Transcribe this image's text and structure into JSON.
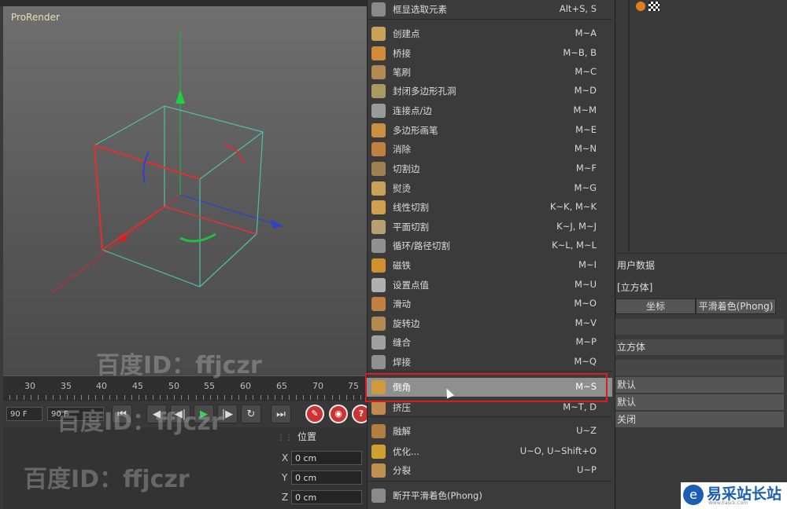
{
  "viewport": {
    "title": "ProRender"
  },
  "timeline": {
    "ticks": [
      "30",
      "35",
      "40",
      "45",
      "50",
      "55",
      "60",
      "65",
      "70",
      "75"
    ]
  },
  "transport": {
    "start_frame": "90 F",
    "end_frame": "90 F"
  },
  "coordinates": {
    "header": "位置",
    "x_label": "X",
    "x_value": "0 cm",
    "y_label": "Y",
    "y_value": "0 cm",
    "z_label": "Z",
    "z_value": "0 cm"
  },
  "menu": {
    "items": [
      {
        "label": "框显选取元素",
        "shortcut": "Alt+S, S",
        "icon": "frame-selection-icon",
        "color": "#8a8a8a"
      },
      {
        "label": "创建点",
        "shortcut": "M~A",
        "icon": "create-point-icon",
        "color": "#c9a25a"
      },
      {
        "label": "桥接",
        "shortcut": "M~B, B",
        "icon": "bridge-icon",
        "color": "#d08a3a"
      },
      {
        "label": "笔刷",
        "shortcut": "M~C",
        "icon": "brush-icon",
        "color": "#b08a50"
      },
      {
        "label": "封闭多边形孔洞",
        "shortcut": "M~D",
        "icon": "close-polygon-hole-icon",
        "color": "#a89a60"
      },
      {
        "label": "连接点/边",
        "shortcut": "M~M",
        "icon": "connect-points-edges-icon",
        "color": "#9a9a9a"
      },
      {
        "label": "多边形画笔",
        "shortcut": "M~E",
        "icon": "polygon-pen-icon",
        "color": "#c89040"
      },
      {
        "label": "消除",
        "shortcut": "M~N",
        "icon": "dissolve-icon",
        "color": "#c08040"
      },
      {
        "label": "切割边",
        "shortcut": "M~F",
        "icon": "edge-cut-icon",
        "color": "#a08050"
      },
      {
        "label": "熨烫",
        "shortcut": "M~G",
        "icon": "iron-icon",
        "color": "#c9a25a"
      },
      {
        "label": "线性切割",
        "shortcut": "K~K, M~K",
        "icon": "line-cut-icon",
        "color": "#d0a050"
      },
      {
        "label": "平面切割",
        "shortcut": "K~J, M~J",
        "icon": "plane-cut-icon",
        "color": "#b8a070"
      },
      {
        "label": "循环/路径切割",
        "shortcut": "K~L, M~L",
        "icon": "loop-path-cut-icon",
        "color": "#909090"
      },
      {
        "label": "磁铁",
        "shortcut": "M~I",
        "icon": "magnet-icon",
        "color": "#d09030"
      },
      {
        "label": "设置点值",
        "shortcut": "M~U",
        "icon": "set-point-value-icon",
        "color": "#b0b0b0"
      },
      {
        "label": "滑动",
        "shortcut": "M~O",
        "icon": "slide-icon",
        "color": "#c08040"
      },
      {
        "label": "旋转边",
        "shortcut": "M~V",
        "icon": "spin-edge-icon",
        "color": "#b08a50"
      },
      {
        "label": "缝合",
        "shortcut": "M~P",
        "icon": "stitch-icon",
        "color": "#a0a0a0"
      },
      {
        "label": "焊接",
        "shortcut": "M~Q",
        "icon": "weld-icon",
        "color": "#909090"
      },
      {
        "label": "倒角",
        "shortcut": "M~S",
        "icon": "bevel-icon",
        "color": "#d09a40",
        "highlighted": true
      },
      {
        "label": "挤压",
        "shortcut": "M~T, D",
        "icon": "extrude-icon",
        "color": "#c08a50"
      },
      {
        "label": "融解",
        "shortcut": "U~Z",
        "icon": "melt-icon",
        "color": "#b08040"
      },
      {
        "label": "优化...",
        "shortcut": "U~O, U~Shift+O",
        "icon": "optimize-icon",
        "color": "#d0a030"
      },
      {
        "label": "分裂",
        "shortcut": "U~P",
        "icon": "split-icon",
        "color": "#c09050"
      },
      {
        "label": "断开平滑着色(Phong)",
        "shortcut": "",
        "icon": "break-phong-icon",
        "color": "#8a8a8a"
      }
    ]
  },
  "attributes": {
    "tab_user_data": "用户数据",
    "object_name": "[立方体]",
    "button_coords": "坐标",
    "button_phong": "平滑着色(Phong)",
    "name_value": "立方体",
    "row_1": "默认",
    "row_2": "默认",
    "row_3": "关闭"
  },
  "watermarks": {
    "text_1": "百度ID：ffjczr",
    "text_2": "百度ID：ffjczr",
    "text_3": "百度ID：ffjczr"
  },
  "logo": {
    "text": "易采站长站",
    "sub": "Www.Easck.Com"
  }
}
